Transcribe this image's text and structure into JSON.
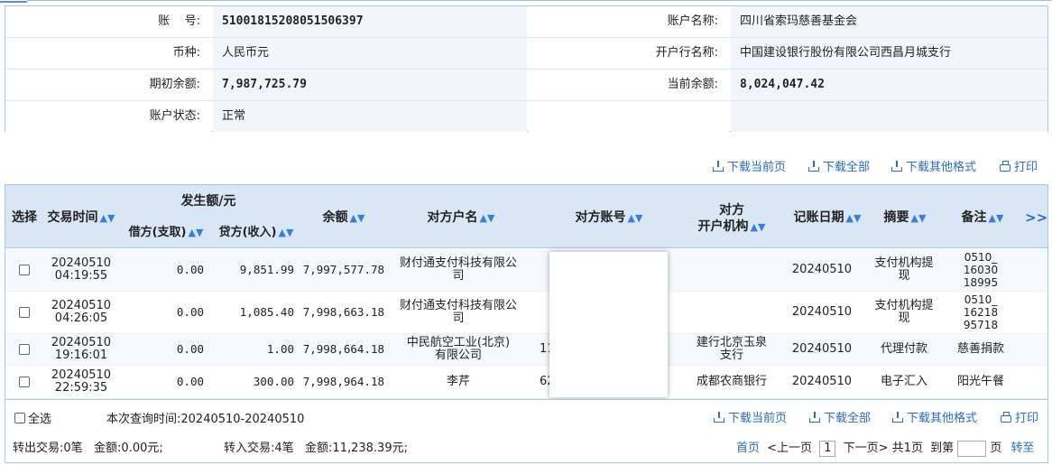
{
  "account": {
    "account_no_label": "账    号:",
    "account_no": "51001815208051506397",
    "account_name_label": "账户名称:",
    "account_name": "四川省索玛慈善基金会",
    "currency_label": "币种:",
    "currency": "人民币元",
    "bank_label": "开户行名称:",
    "bank": "中国建设银行股份有限公司西昌月城支行",
    "opening_balance_label": "期初余额:",
    "opening_balance": "7,987,725.79",
    "current_balance_label": "当前余额:",
    "current_balance": "8,024,047.42",
    "status_label": "账户状态:",
    "status": "正常"
  },
  "toolbar": {
    "download_page": "下载当前页",
    "download_all": "下载全部",
    "download_other": "下载其他格式",
    "print": "打印"
  },
  "table": {
    "headers": {
      "select": "选择",
      "time": "交易时间",
      "amount_group": "发生额/元",
      "debit": "借方(支取)",
      "credit": "贷方(收入)",
      "balance": "余额",
      "counterparty_name": "对方户名",
      "counterparty_account": "对方账号",
      "counterparty_bank_line1": "对方",
      "counterparty_bank_line2": "开户机构",
      "post_date": "记账日期",
      "summary": "摘要",
      "remark": "备注",
      "more": ">>"
    },
    "sort_icon": "sort-arrows-icon",
    "rows": [
      {
        "date": "20240510",
        "time": "04:19:55",
        "debit": "0.00",
        "credit": "9,851.99",
        "balance": "7,997,577.78",
        "name1": "财付通支付科技有限公",
        "name2": "司",
        "account": "",
        "bank1": "",
        "bank2": "",
        "post_date": "20240510",
        "summary1": "支付机构提",
        "summary2": "现",
        "remark1": "0510_",
        "remark2": "16030",
        "remark3": "18995"
      },
      {
        "date": "20240510",
        "time": "04:26:05",
        "debit": "0.00",
        "credit": "1,085.40",
        "balance": "7,998,663.18",
        "name1": "财付通支付科技有限公",
        "name2": "司",
        "account": "",
        "bank1": "",
        "bank2": "",
        "post_date": "20240510",
        "summary1": "支付机构提",
        "summary2": "现",
        "remark1": "0510_",
        "remark2": "16218",
        "remark3": "95718"
      },
      {
        "date": "20240510",
        "time": "19:16:01",
        "debit": "0.00",
        "credit": "1.00",
        "balance": "7,998,664.18",
        "name1": "中民航空工业(北京)",
        "name2": "有限公司",
        "account": "11",
        "bank1": "建行北京玉泉",
        "bank2": "支行",
        "post_date": "20240510",
        "summary1": "代理付款",
        "summary2": "",
        "remark1": "慈善捐款",
        "remark2": "",
        "remark3": ""
      },
      {
        "date": "20240510",
        "time": "22:59:35",
        "debit": "0.00",
        "credit": "300.00",
        "balance": "7,998,964.18",
        "name1": "李芹",
        "name2": "",
        "account": "62",
        "bank1": "成都农商银行",
        "bank2": "",
        "post_date": "20240510",
        "summary1": "电子汇入",
        "summary2": "",
        "remark1": "阳光午餐",
        "remark2": "",
        "remark3": ""
      }
    ]
  },
  "footer": {
    "select_all": "全选",
    "query_time": "本次查询时间:20240510-20240510",
    "out_summary": "转出交易:0笔   金额:0.00元;",
    "in_summary": "转入交易:4笔   金额:11,238.39元;",
    "first": "首页",
    "prev": "<上一页",
    "page": "1",
    "next": "下一页>",
    "total": "共1页",
    "goto": "到第",
    "page_unit": "页",
    "jump": "转至"
  }
}
